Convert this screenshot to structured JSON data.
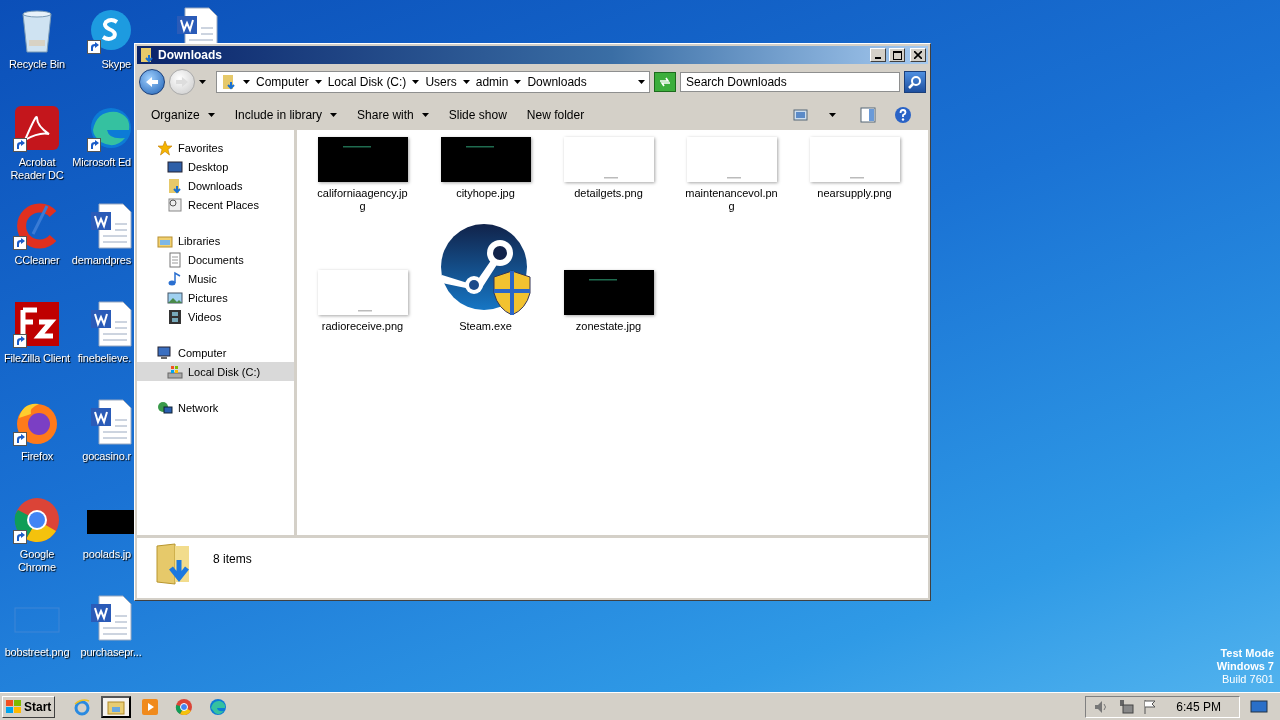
{
  "desktop": {
    "columns": [
      [
        {
          "label": "Recycle Bin",
          "kind": "recycle",
          "shortcut": false
        },
        {
          "label": "Acrobat Reader DC",
          "kind": "acrobat",
          "shortcut": true
        },
        {
          "label": "CCleaner",
          "kind": "ccleaner",
          "shortcut": true
        },
        {
          "label": "FileZilla Client",
          "kind": "filezilla",
          "shortcut": true
        },
        {
          "label": "Firefox",
          "kind": "firefox",
          "shortcut": true
        },
        {
          "label": "Google Chrome",
          "kind": "chrome",
          "shortcut": true
        },
        {
          "label": "bobstreet.png",
          "kind": "image-light",
          "shortcut": false
        }
      ],
      [
        {
          "label": "Skype",
          "kind": "skype",
          "shortcut": true
        },
        {
          "label": "Microsoft Ed",
          "kind": "edge",
          "shortcut": true
        },
        {
          "label": "demandpres",
          "kind": "word",
          "shortcut": false
        },
        {
          "label": "finebelieve.",
          "kind": "word",
          "shortcut": false
        },
        {
          "label": "gocasino.r",
          "kind": "word",
          "shortcut": false
        },
        {
          "label": "poolads.jp",
          "kind": "image-dark",
          "shortcut": false
        },
        {
          "label": "purchasepr...",
          "kind": "word",
          "shortcut": false
        }
      ],
      [
        {
          "kind": "word",
          "shortcut": false
        }
      ]
    ]
  },
  "window": {
    "title": "Downloads"
  },
  "address": {
    "crumbs": [
      "Computer",
      "Local Disk (C:)",
      "Users",
      "admin",
      "Downloads"
    ]
  },
  "search": {
    "placeholder": "Search Downloads"
  },
  "toolbar": {
    "items": [
      {
        "label": "Organize",
        "dropdown": true
      },
      {
        "label": "Include in library",
        "dropdown": true
      },
      {
        "label": "Share with",
        "dropdown": true
      },
      {
        "label": "Slide show",
        "dropdown": false
      },
      {
        "label": "New folder",
        "dropdown": false
      }
    ]
  },
  "nav": [
    {
      "label": "Favorites",
      "kind": "star",
      "selected": false,
      "children": [
        {
          "label": "Desktop",
          "kind": "desktop",
          "selected": false
        },
        {
          "label": "Downloads",
          "kind": "download-folder",
          "selected": false
        },
        {
          "label": "Recent Places",
          "kind": "recent",
          "selected": false
        }
      ]
    },
    {
      "label": "Libraries",
      "kind": "library",
      "selected": false,
      "children": [
        {
          "label": "Documents",
          "kind": "document",
          "selected": false
        },
        {
          "label": "Music",
          "kind": "music",
          "selected": false
        },
        {
          "label": "Pictures",
          "kind": "pictures",
          "selected": false
        },
        {
          "label": "Videos",
          "kind": "videos",
          "selected": false
        }
      ]
    },
    {
      "label": "Computer",
      "kind": "computer",
      "selected": false,
      "children": [
        {
          "label": "Local Disk (C:)",
          "kind": "disk",
          "selected": true
        }
      ]
    },
    {
      "label": "Network",
      "kind": "network",
      "selected": false
    }
  ],
  "files": [
    {
      "name": "californiaagency.jpg",
      "kind": "dark"
    },
    {
      "name": "cityhope.jpg",
      "kind": "dark"
    },
    {
      "name": "detailgets.png",
      "kind": "light"
    },
    {
      "name": "maintenancevol.png",
      "kind": "light"
    },
    {
      "name": "nearsupply.png",
      "kind": "light"
    },
    {
      "name": "radioreceive.png",
      "kind": "light"
    },
    {
      "name": "Steam.exe",
      "kind": "app"
    },
    {
      "name": "zonestate.jpg",
      "kind": "dark"
    }
  ],
  "details": {
    "count": "8 items"
  },
  "os_notice": [
    "Test Mode",
    "Windows 7",
    "Build 7601"
  ],
  "taskbar": {
    "start": "Start",
    "apps": [
      {
        "kind": "ie",
        "selected": false
      },
      {
        "kind": "explorer",
        "selected": true
      },
      {
        "kind": "media",
        "selected": false
      },
      {
        "kind": "chrome",
        "selected": false
      },
      {
        "kind": "edge",
        "selected": false
      }
    ],
    "clock": "6:45 PM"
  }
}
